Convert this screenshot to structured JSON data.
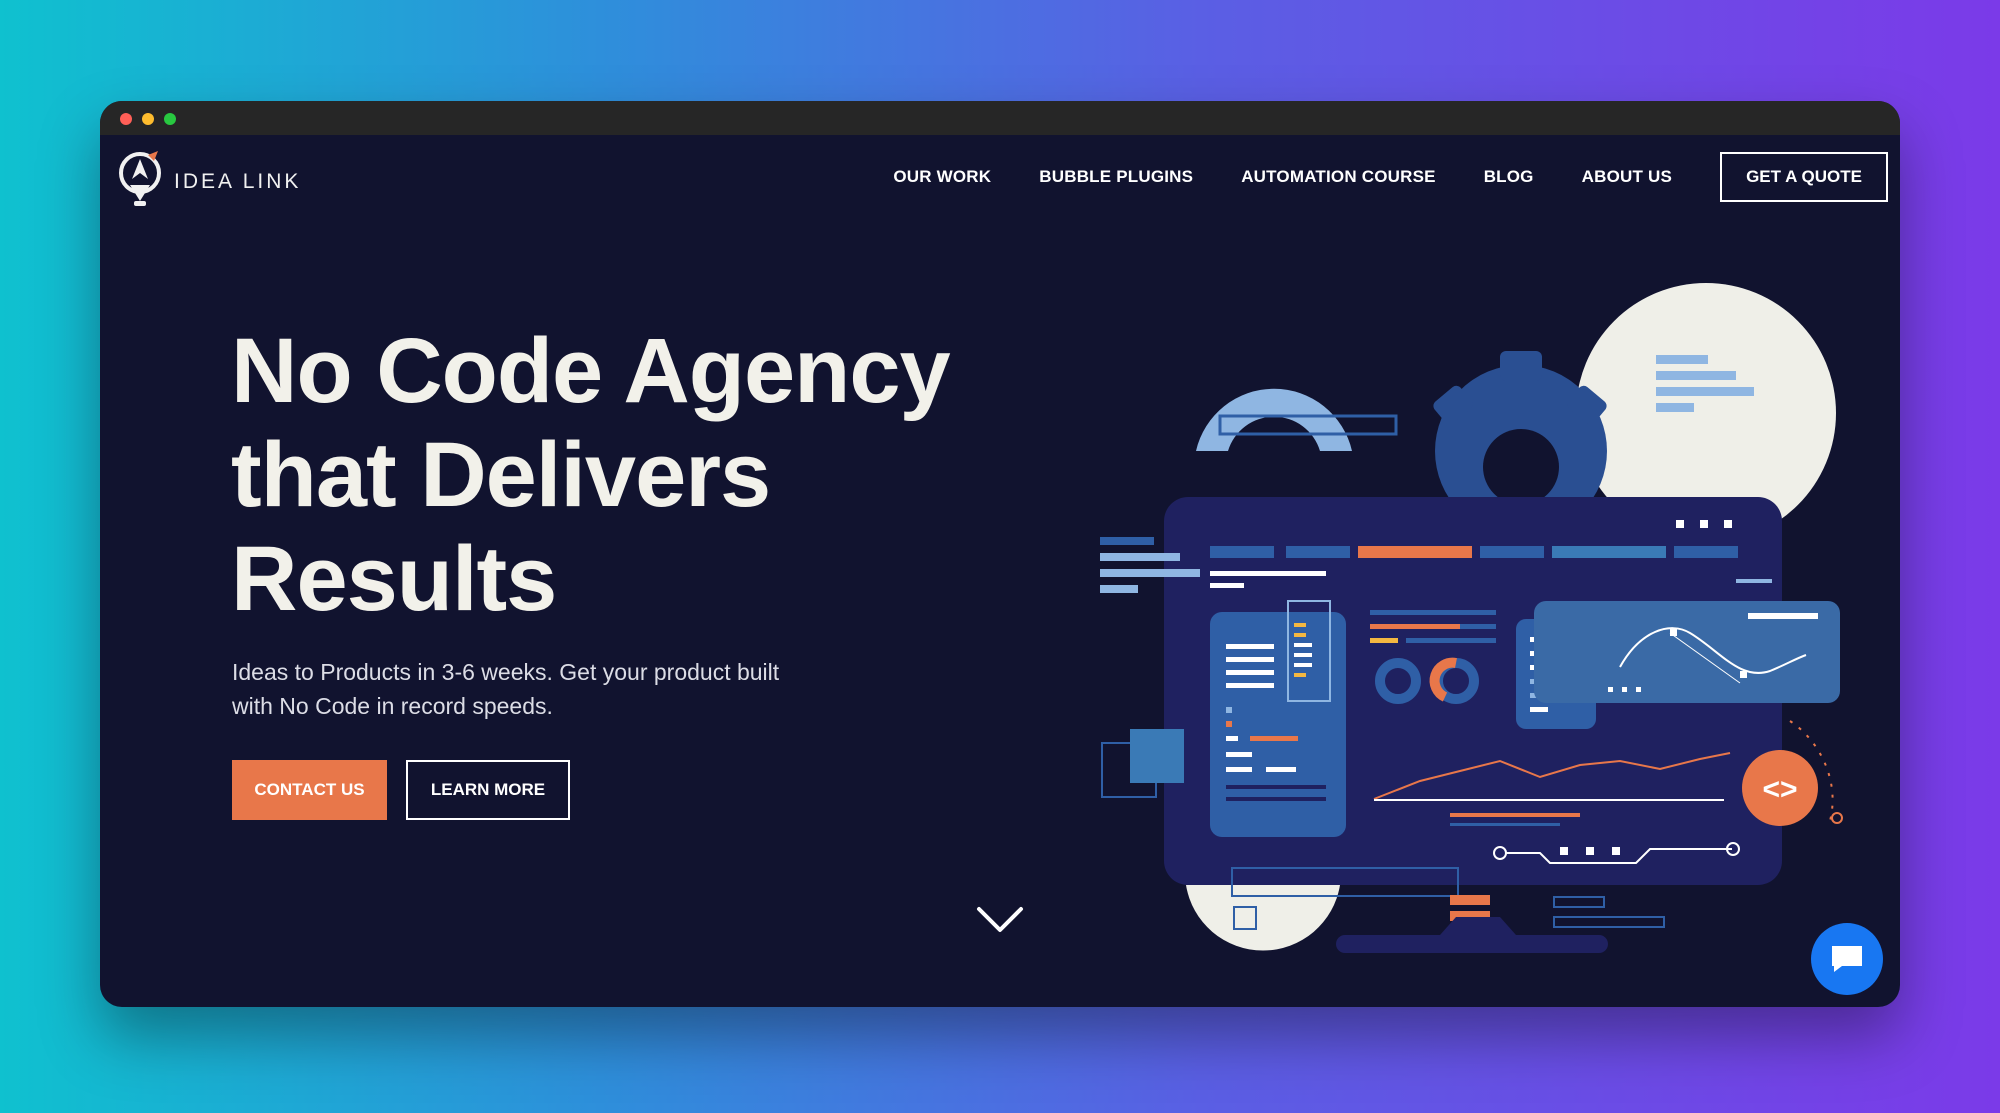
{
  "brand": {
    "name": "IDEA LINK"
  },
  "nav": {
    "items": [
      {
        "label": "OUR WORK"
      },
      {
        "label": "BUBBLE PLUGINS"
      },
      {
        "label": "AUTOMATION COURSE"
      },
      {
        "label": "BLOG"
      },
      {
        "label": "ABOUT US"
      }
    ],
    "cta_label": "GET A QUOTE"
  },
  "hero": {
    "title_lines": [
      "No Code Agency",
      "that Delivers",
      "Results"
    ],
    "subtitle_lines": [
      "Ideas to Products in 3-6 weeks. Get your product built",
      "with No Code in record speeds."
    ],
    "primary_button": "CONTACT US",
    "secondary_button": "LEARN MORE"
  },
  "illustration": {
    "code_badge": "<>"
  },
  "icons": {
    "logo": "lightbulb-logo-icon",
    "scroll": "chevron-down-icon",
    "chat": "chat-bubble-icon"
  },
  "colors": {
    "page_background": "#11132f",
    "accent_orange": "#e8774a",
    "chat_blue": "#1877f2",
    "illustration_panel": "#1f2160",
    "illustration_blue": "#2f5fa6",
    "illustration_light_blue": "#8fb6e2",
    "illustration_cream": "#efefe8"
  }
}
